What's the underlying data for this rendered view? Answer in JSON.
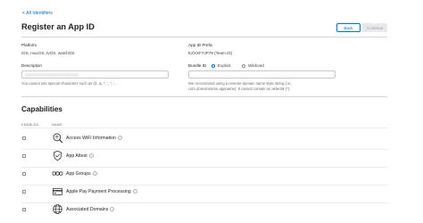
{
  "header": {
    "back_link": "< All Identifiers",
    "title": "Register an App ID",
    "back_button": "Back",
    "continue_button": "Continue"
  },
  "platform": {
    "label": "Platform",
    "value": "iOS, macOS, tvOS, watchOS"
  },
  "prefix": {
    "label": "App ID Prefix",
    "value": "EZXXF7JP79 (Team ID)"
  },
  "description": {
    "label": "Description",
    "value": "",
    "help": "You cannot use special characters such as @, &, *, ', \", -, ."
  },
  "bundle_id": {
    "label": "Bundle ID",
    "explicit_label": "Explicit",
    "wildcard_label": "Wildcard",
    "selected": "Explicit",
    "value": "",
    "help_line1": "We recommend using a reverse-domain name style string (i.e.,",
    "help_line2": "com.domainname.appname). It cannot contain an asterisk (*)."
  },
  "capabilities": {
    "title": "Capabilities",
    "col_enabled": "ENABLED",
    "col_name": "NAME",
    "items": [
      {
        "name": "Access WiFi Information",
        "icon": "wifi-search-icon",
        "enabled": false
      },
      {
        "name": "App Attest",
        "icon": "app-attest-icon",
        "enabled": false
      },
      {
        "name": "App Groups",
        "icon": "app-groups-icon",
        "enabled": false
      },
      {
        "name": "Apple Pay Payment Processing",
        "icon": "apple-pay-icon",
        "enabled": false
      },
      {
        "name": "Associated Domains",
        "icon": "globe-icon",
        "enabled": false
      }
    ]
  },
  "colors": {
    "accent": "#0070c9",
    "text": "#1d1d1f",
    "muted": "#6e6e73"
  }
}
